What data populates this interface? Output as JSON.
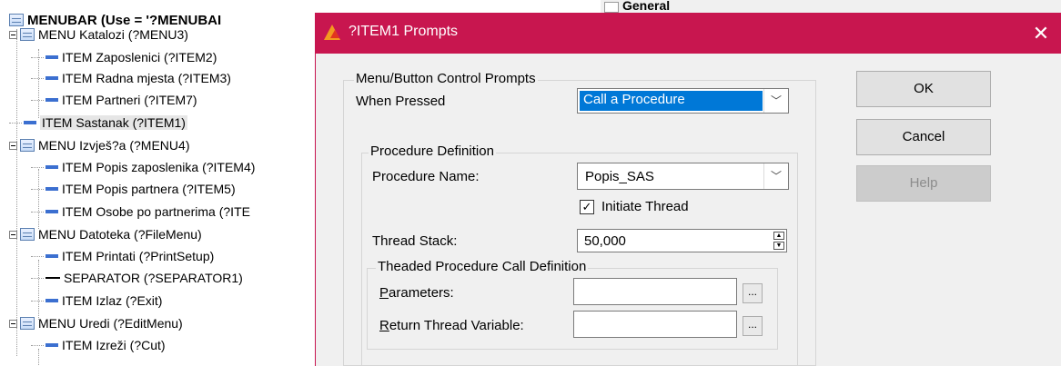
{
  "tree": {
    "root": "MENUBAR (Use = '?MENUBAI",
    "rows": [
      {
        "label": "MENU  Katalozi  (?MENU3)"
      },
      {
        "label": "ITEM  Zaposlenici  (?ITEM2)"
      },
      {
        "label": "ITEM  Radna mjesta  (?ITEM3)"
      },
      {
        "label": "ITEM  Partneri  (?ITEM7)"
      },
      {
        "label": "ITEM  Sastanak  (?ITEM1)"
      },
      {
        "label": "MENU  Izvješ?a  (?MENU4)"
      },
      {
        "label": "ITEM  Popis zaposlenika  (?ITEM4)"
      },
      {
        "label": "ITEM  Popis partnera  (?ITEM5)"
      },
      {
        "label": "ITEM  Osobe po partnerima  (?ITE"
      },
      {
        "label": "MENU  Datoteka  (?FileMenu)"
      },
      {
        "label": "ITEM  Printati  (?PrintSetup)"
      },
      {
        "label": "SEPARATOR   (?SEPARATOR1)"
      },
      {
        "label": "ITEM  Izlaz  (?Exit)"
      },
      {
        "label": "MENU  Uredi  (?EditMenu)"
      },
      {
        "label": "ITEM  Izreži  (?Cut)"
      }
    ]
  },
  "background_tab": "General",
  "dialog": {
    "title": "?ITEM1 Prompts",
    "close_glyph": "✕",
    "menu_group_title": "Menu/Button Control Prompts",
    "when_pressed_label": "When Pressed",
    "when_pressed_value": "Call a Procedure",
    "proc_group_title": "Procedure Definition",
    "proc_name_label": "Procedure Name:",
    "proc_name_value": "Popis_SAS",
    "initiate_thread_label": "Initiate Thread",
    "initiate_thread_checked": true,
    "thread_stack_label": "Thread Stack:",
    "thread_stack_value": "50,000",
    "threaded_group_title": "Theaded Procedure Call Definition",
    "parameters_label_first": "P",
    "parameters_label_rest": "arameters:",
    "parameters_value": "",
    "return_label_first": "R",
    "return_label_rest": "eturn Thread Variable:",
    "return_value": "",
    "ellipsis": "...",
    "ok": "OK",
    "cancel": "Cancel",
    "help": "Help",
    "chevron": "﹀",
    "check_glyph": "✓",
    "spin_up": "▲",
    "spin_down": "▼"
  }
}
